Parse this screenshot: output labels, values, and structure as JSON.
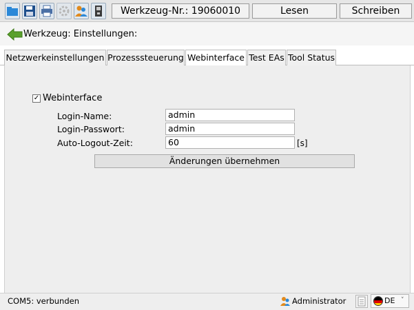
{
  "toolbar": {
    "buttons": [
      {
        "name": "open-folder-icon",
        "color": "#2b88d8"
      },
      {
        "name": "save-disk-icon",
        "color": "#1e4f8c"
      },
      {
        "name": "printer-icon",
        "color": "#4a6fa5"
      },
      {
        "name": "settings-gear-icon",
        "color": "#b0b0b0"
      },
      {
        "name": "user-group-icon",
        "color": "#e08a1e"
      },
      {
        "name": "device-icon",
        "color": "#3a3a3a"
      }
    ],
    "tool_number": "Werkzeug-Nr.: 19060010",
    "read_label": "Lesen",
    "write_label": "Schreiben"
  },
  "title": "Werkzeug: Einstellungen:",
  "tabs": [
    {
      "label": "Netzwerkeinstellungen",
      "active": false
    },
    {
      "label": "Prozesssteuerung",
      "active": false
    },
    {
      "label": "Webinterface",
      "active": true
    },
    {
      "label": "Test EAs",
      "active": false
    },
    {
      "label": "Tool Status",
      "active": false
    }
  ],
  "webinterface": {
    "enabled_label": "Webinterface",
    "enabled": true,
    "check_mark": "✓",
    "login_name_label": "Login-Name:",
    "login_name_value": "admin",
    "login_password_label": "Login-Passwort:",
    "login_password_value": "admin",
    "auto_logout_label": "Auto-Logout-Zeit:",
    "auto_logout_value": "60",
    "auto_logout_unit": "[s]",
    "apply_label": "Änderungen übernehmen"
  },
  "status": {
    "connection": "COM5: verbunden",
    "user": "Administrator",
    "language": "DE",
    "chevron": "˅"
  },
  "colors": {
    "accent_green": "#5aa02c",
    "flag_black": "#000000",
    "flag_red": "#dd0000",
    "flag_gold": "#ffce00"
  }
}
